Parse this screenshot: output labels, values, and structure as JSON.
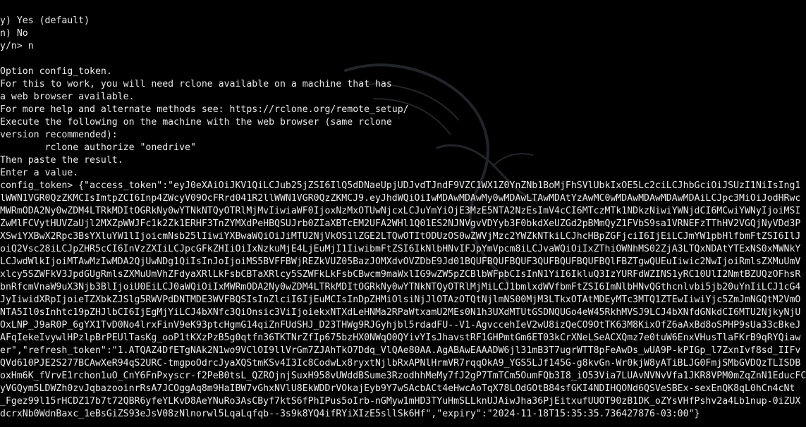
{
  "terminal": {
    "background": "#000000",
    "foreground": "#eaeaea",
    "lines": [
      "y) Yes (default)",
      "n) No",
      "y/n> n",
      "",
      "Option config_token.",
      "For this to work, you will need rclone available on a machine that has",
      "a web browser available.",
      "For more help and alternate methods see: https://rclone.org/remote_setup/",
      "Execute the following on the machine with the web browser (same rclone",
      "version recommended):",
      "        rclone authorize \"onedrive\"",
      "Then paste the result.",
      "Enter a value.",
      "config_token> {\"access_token\":\"eyJ0eXAiOiJKV1QiLCJub25jZSI6IlQ5dDNaeUpjUDJvdTJndF9VZC1WX1Z0YnZNb1BoMjFhSVlUbkIxOE5Lc2ciLCJhbGciOiJSUzI1NiIsIng1",
      "lWWN1VGR0QzZKMCIsImtpZCI6Inp4ZWcyV09OcFRrd041R2llWWN1VGR0QzZKMCJ9.eyJhdWQiOiIwMDAwMDAwMy0wMDAwLTAwMDAtYzAwMC0wMDAwMDAwMDAwMDAiLCJpc3MiOiJodHRwc",
      "MWRmODA2Ny0wZDM4LTRkMDItOGRkNy0wYTNkNTQyOTRlMjMvIiwiaWF0IjoxNzMxOTUwNjcxLCJuYmYiOjE3MzE5NTA2NzEsImV4cCI6MTczMTk1NDkzNiwiYWNjdCI6MCwiYWNyIjoiMSI",
      "ZwMlFCVytHUVZaUjl2MXZpWWJFc1k2Zk1ERHF3TnZYMXdPeHBQSUJrb0ZIaXBTcEM2UFA2WHl1Q01ES2NJNVgvVDYyb3F0bkdXeUZGd2pBMmQyZ1FVbS9sa1VRNEFzTThHV2VGQjNyVDd3P",
      "XSwiYXBwX2Rpc3BsYXluYW1lIjoicmNsb25lIiwiYXBwaWQiOiJiMTU2NjVkOS1lZGE2LTQwOTItODUzOS0wZWVjMzc2YWZkNTkiLCJhcHBpZGFjciI6IjEiLCJmYW1pbHlfbmFtZSI6IlJ",
      "oiQ2Vsc28iLCJpZHR5cCI6InVzZXIiLCJpcGFkZHIiOiIxNzkuMjE4LjEuMjI1IiwibmFtZSI6IkNlbHNvIFJpYmVpcm8iLCJvaWQiOiIxZThiOWNhMS02ZjA3LTQxNDAtYTExNS0xMWNkY",
      "LCJwdWlkIjoiMTAwMzIwMDA2QjUwNDg1QiIsInJoIjoiMS5BVFFBWjREZkVUZ05BazJOMXdvOVZDbE9Jd01BQUFBQUFBQUF3QUFBQUFBQUFBQlFBZTgwQUEuIiwic2NwIjoiRmlsZXMuUmV",
      "xlcy5SZWFkV3JpdGUgRmlsZXMuUmVhZFdyaXRlLkFsbCBTaXRlcy5SZWFkLkFsbCBwcm9maWxlIG9wZW5pZCBlbWFpbCIsInN1YiI6IkluQ3IzYURFdWZINS1yRC10UlI2NmtBZUQzOFhsR",
      "bnRfcmVnaW9uX3Njb3BlIjoiU0EiLCJ0aWQiOiIxMWRmODA2Ny0wZDM4LTRkMDItOGRkNy0wYTNkNTQyOTRlMjMiLCJ1bmlxdWVfbmFtZSI6ImNlbHNvQGthcnlvbi5jb20uYnIiLCJ1cG4",
      "JyIiwidXRpIjoieTZXbkZJSlg5RWVPdDNTMDE3WVFBQSIsInZlciI6IjEuMCIsInDpZHMiOlsiNjJlOTAzOTQtNjlmNS00MjM3LTkxOTAtMDEyMTc3MTQ1ZTEwIiwiYjc5ZmJmNGQtM2VmO",
      "NTA5Il0sInhtc19pZHJlbCI6IjEgMjYiLCJ4bXNfc3QiOnsic3ViIjoiekxNTXdLeHNMa2RPaWtxamU2MEs0N1h3UXdMTUtGSDNQUGo4eW45RkhMVSJ9LCJ4bXNfdGNkdCI6MTU2NjkyNjU",
      "OxLNP_J9aR0P_6gYX1TvD0No4lrxFinV9eK93ptcHgmG14qiZnFUdSHJ_D23THWg9RJGyhjbl5rdadFU--V1-AgvccehIeV2wU8izQeCO9OtTK63M8KixOfZ6aAxBd8oSPHP9sUa33cBkeJ",
      "AFqIekeIvywlHPzlpBrPEUlTasKg_ooP1tKXzPzB5g0qtfn36TKTNrZfIp675bzHX0NWqO0QYivYIsJhavstRF1GHPmtGm6ET03kCrXNeLSeACXQmz7e0tuW6EnxVHusTlaFKrB9qRYQiaw",
      "er\",\"refresh_token\":\"1.ATQAZ4DfETgNAk2N1wo9VClOI9llVrGm7ZJAhTkO7Ddq_VlQAe80AA.AgABAwEAAADW6jl31mB3T7ugrWTT8pFeAwDs_wUA9P-kPIGp_l7ZxnIvf8sd_IIFv",
      "QVd610PJE2S277BCAwXeR94qS2URC-tmgpoOdrcJyaXQStmKSv4I3Ic8CodwLx8ryxtNjlbRxAPNlHrmVR7rqqOkA9_YGS5LJf145G-g8kvGn-Wr0kjW8yATiBLJG0FmjSMbGVDQzTLISDB",
      "oxHm6K_fVrvE1rchon1uO_CnY6FnPxyscr-f2PeB0tsL_QZROjnjSuxH958vUWddBSume3RzodhhMeMy7fJ2gP7TmTCm5OumFQb3I8_iO53Via7LUAvNVNvVfa1JKR8VPM0mZqZnN1EducFC",
      "yVGQym5LDWZh0zvJqbazooinrRsA7JCOggAq8m9HaIBW7vGhxNVlU8EkWDDrVOkajEyb9Y7wSAcbACt4eHwcAoTqX78LOdGOtB84sfGKI4NDIHQONd6QSVeSBEx-sexEnQK8qL0hCn4cNt",
      "_Fgez99l15rHCDZ17b7t72QBR6yfeYLKvD8AeYNuRo3AsCByf7ktS6fPhIPus5oIrb-nGMyw1mHD3TYuHmSLLknUJAiwJha36PjEitxufUUOT90zB1DK_oZYsVHfPshv2a4Lb1nup-0iZUX",
      "dcrxNb0WdnBaxc_1eBsGiZS93eJsV08zNlnorwl5LqaLqfqb--3s9k8YQ4ifRYiXIzE5sllSk6Hf\",\"expiry\":\"2024-11-18T15:35:35.736427876-03:00\"}"
    ]
  }
}
